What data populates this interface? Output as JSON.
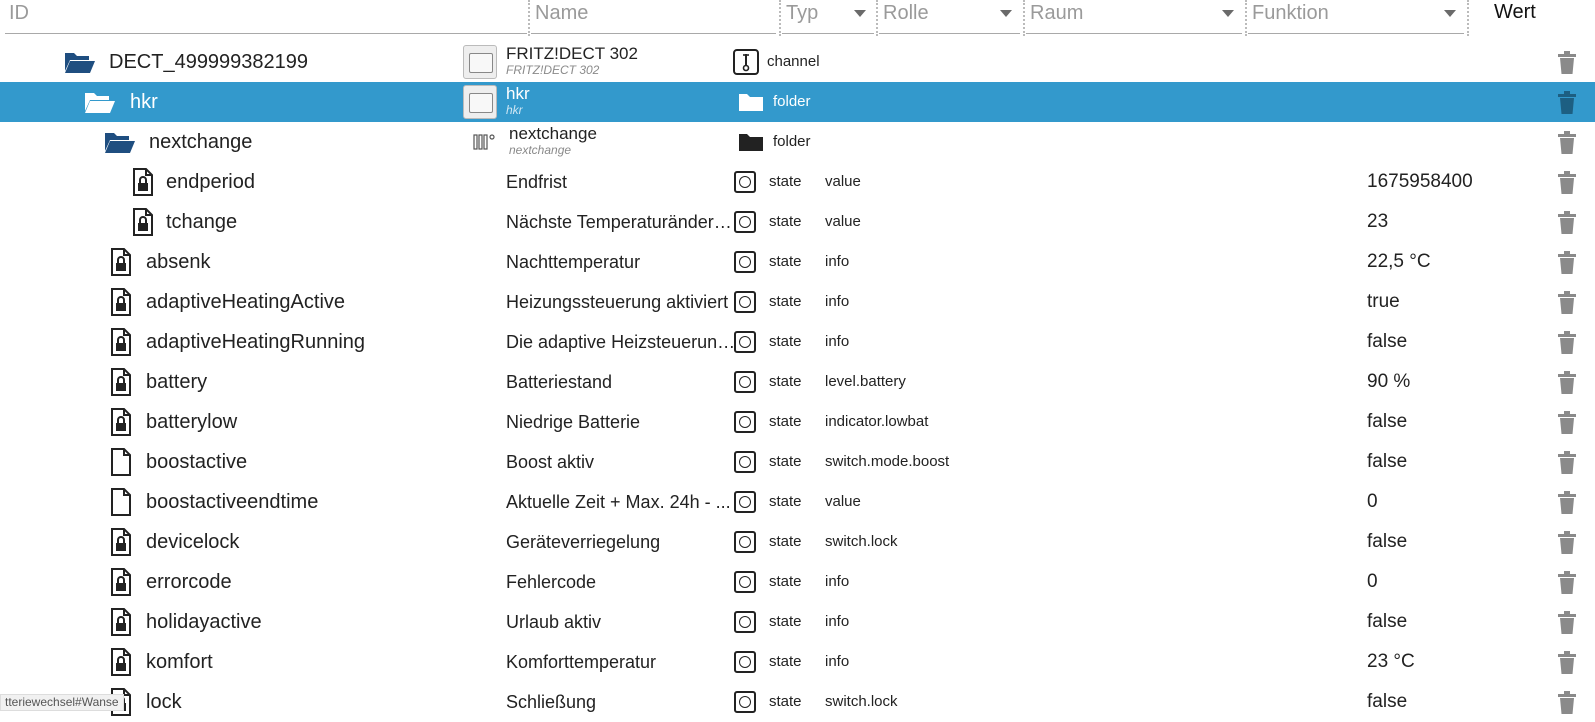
{
  "filters": {
    "id_placeholder": "ID",
    "name_placeholder": "Name",
    "typ_placeholder": "Typ",
    "rolle_placeholder": "Rolle",
    "raum_placeholder": "Raum",
    "funktion_placeholder": "Funktion",
    "wert_label": "Wert"
  },
  "colors": {
    "highlight": "#3399cc",
    "folder_dark": "#1f4e80",
    "trash": "#8a8a8a"
  },
  "rows": [
    {
      "id": "DECT_499999382199",
      "name": "FRITZ!DECT 302",
      "name_sub": "FRITZ!DECT 302",
      "type": "channel",
      "role": "",
      "value": "",
      "icon": "folder-open-icon"
    },
    {
      "id": "hkr",
      "name": "hkr",
      "name_sub": "hkr",
      "type": "folder",
      "role": "",
      "value": "",
      "icon": "folder-open-icon",
      "selected": true
    },
    {
      "id": "nextchange",
      "name": "nextchange",
      "name_sub": "nextchange",
      "type": "folder",
      "role": "",
      "value": "",
      "icon": "folder-open-icon"
    },
    {
      "id": "endperiod",
      "name": "Endfrist",
      "type": "state",
      "role": "value",
      "value": "1675958400",
      "icon": "locked-file-icon"
    },
    {
      "id": "tchange",
      "name": "Nächste Temperaturänderu...",
      "type": "state",
      "role": "value",
      "value": "23",
      "icon": "locked-file-icon"
    },
    {
      "id": "absenk",
      "name": "Nachttemperatur",
      "type": "state",
      "role": "info",
      "value": "22,5 °C",
      "icon": "locked-file-icon"
    },
    {
      "id": "adaptiveHeatingActive",
      "name": "Heizungssteuerung aktiviert",
      "type": "state",
      "role": "info",
      "value": "true",
      "icon": "locked-file-icon"
    },
    {
      "id": "adaptiveHeatingRunning",
      "name": "Die adaptive Heizsteuerung...",
      "type": "state",
      "role": "info",
      "value": "false",
      "icon": "locked-file-icon"
    },
    {
      "id": "battery",
      "name": "Batteriestand",
      "type": "state",
      "role": "level.battery",
      "value": "90 %",
      "icon": "locked-file-icon"
    },
    {
      "id": "batterylow",
      "name": "Niedrige Batterie",
      "type": "state",
      "role": "indicator.lowbat",
      "value": "false",
      "icon": "locked-file-icon"
    },
    {
      "id": "boostactive",
      "name": "Boost aktiv",
      "type": "state",
      "role": "switch.mode.boost",
      "value": "false",
      "icon": "file-icon"
    },
    {
      "id": "boostactiveendtime",
      "name": "Aktuelle Zeit + Max. 24h - ...",
      "type": "state",
      "role": "value",
      "value": "0",
      "icon": "file-icon"
    },
    {
      "id": "devicelock",
      "name": "Geräteverriegelung",
      "type": "state",
      "role": "switch.lock",
      "value": "false",
      "icon": "locked-file-icon"
    },
    {
      "id": "errorcode",
      "name": "Fehlercode",
      "type": "state",
      "role": "info",
      "value": "0",
      "icon": "locked-file-icon"
    },
    {
      "id": "holidayactive",
      "name": "Urlaub aktiv",
      "type": "state",
      "role": "info",
      "value": "false",
      "icon": "locked-file-icon"
    },
    {
      "id": "komfort",
      "name": "Komforttemperatur",
      "type": "state",
      "role": "info",
      "value": "23 °C",
      "icon": "locked-file-icon"
    },
    {
      "id": "lock",
      "name": "Schließung",
      "type": "state",
      "role": "switch.lock",
      "value": "false",
      "icon": "locked-file-icon"
    }
  ],
  "status_bar": {
    "text": "tteriewechsel#Wanse"
  }
}
